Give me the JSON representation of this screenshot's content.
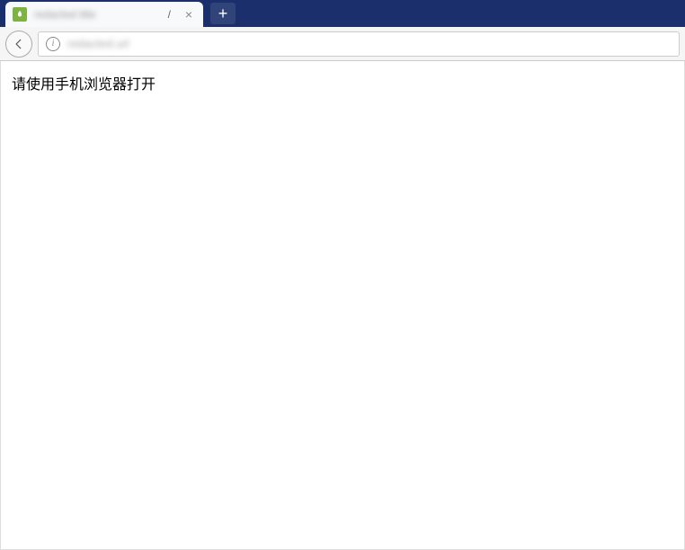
{
  "tab": {
    "title_blurred": "redacted title",
    "slash": "/",
    "close_symbol": "×"
  },
  "newtab": {
    "plus": "+"
  },
  "addressbar": {
    "info_symbol": "i",
    "url_blurred": "redacted.url"
  },
  "content": {
    "message": "请使用手机浏览器打开"
  }
}
